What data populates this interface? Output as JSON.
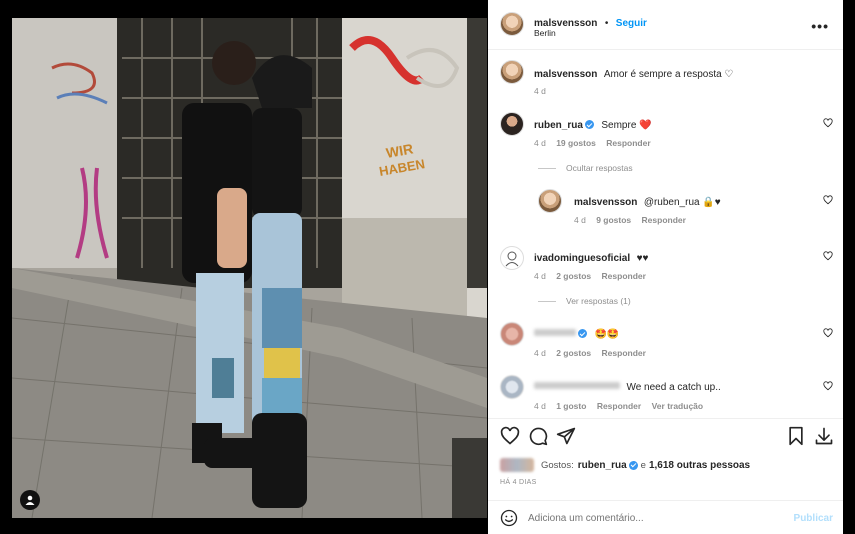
{
  "post": {
    "author": "malsvensson",
    "separator": "•",
    "follow_label": "Seguir",
    "location": "Berlin",
    "more_label": "•••",
    "caption_author": "malsvensson",
    "caption_text": "Amor é sempre a resposta ♡",
    "caption_time": "4 d"
  },
  "comments": [
    {
      "user": "ruben_rua",
      "verified": true,
      "text": "Sempre ❤️",
      "time": "4 d",
      "likes": "19 gostos",
      "reply": "Responder",
      "thread_label": "Ocultar respostas"
    },
    {
      "user": "malsvensson",
      "verified": false,
      "text": "@ruben_rua 🔒♥",
      "time": "4 d",
      "likes": "9 gostos",
      "reply": "Responder"
    },
    {
      "user": "ivadominguesoficial",
      "verified": false,
      "text": "♥♥",
      "time": "4 d",
      "likes": "2 gostos",
      "reply": "Responder",
      "thread_label": "Ver respostas (1)"
    },
    {
      "user": "",
      "verified": true,
      "text": "🤩🤩",
      "time": "4 d",
      "likes": "2 gostos",
      "reply": "Responder"
    },
    {
      "user": "",
      "verified": false,
      "text": "We need a catch up..",
      "time": "4 d",
      "likes": "1 gosto",
      "reply": "Responder",
      "translate": "Ver tradução"
    }
  ],
  "likes": {
    "prefix": "Gostos:",
    "user": "ruben_rua",
    "connector": "e",
    "others": "1,618 outras pessoas"
  },
  "timestamp": "HÁ 4 DIAS",
  "comment_box": {
    "placeholder": "Adiciona um comentário...",
    "publish_label": "Publicar"
  },
  "colors": {
    "accent": "#0095f6",
    "publish_disabled": "#b2dffc",
    "heart_red": "#ed4956"
  }
}
